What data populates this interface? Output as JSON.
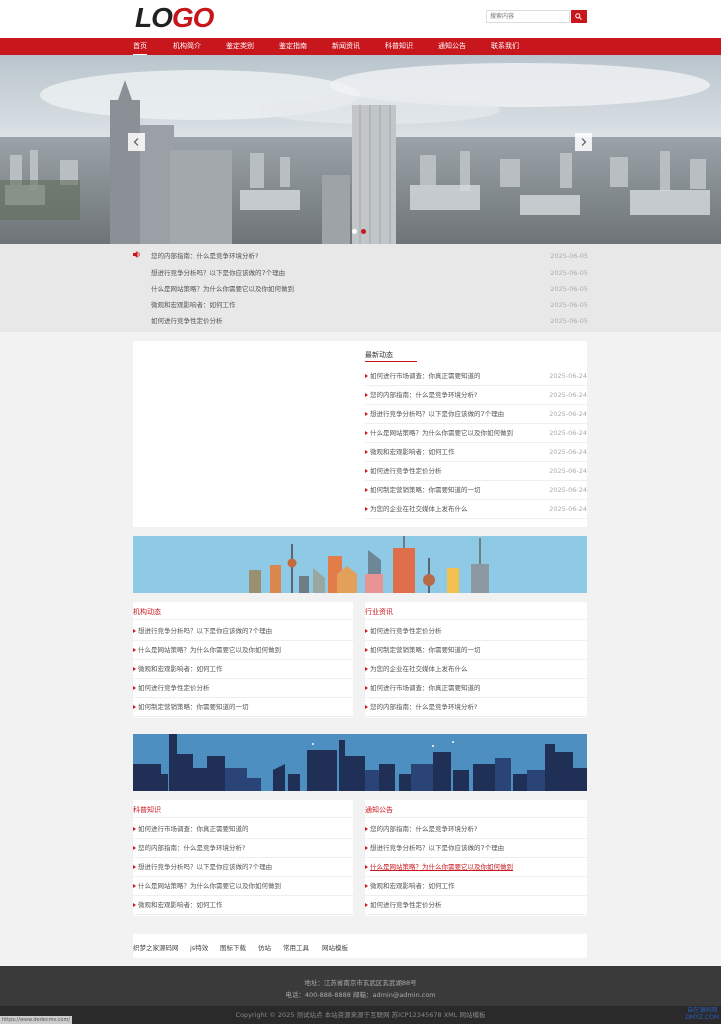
{
  "header": {
    "logo_part1": "LO",
    "logo_part2": "GO",
    "search_placeholder": "搜索内容"
  },
  "nav": {
    "items": [
      "首页",
      "机构简介",
      "鉴定类别",
      "鉴定指南",
      "新闻资讯",
      "科普知识",
      "通知公告",
      "联系我们"
    ]
  },
  "ticker": {
    "items": [
      {
        "title": "您的内部指南：什么是竞争环境分析?",
        "date": "2025-06-05"
      },
      {
        "title": "想进行竞争分析吗？以下是你应该做的7个理由",
        "date": "2025-06-05"
      },
      {
        "title": "什么是网站策略？为什么你需要它以及你如何做到",
        "date": "2025-06-05"
      },
      {
        "title": "微观和宏观影响者：如何工作",
        "date": "2025-06-05"
      },
      {
        "title": "如何进行竞争性定价分析",
        "date": "2025-06-05"
      }
    ]
  },
  "latest": {
    "title": "最新动态",
    "items": [
      {
        "title": "如何进行市场调查：你真正需要知道的",
        "date": "2025-06-24"
      },
      {
        "title": "您的内部指南：什么是竞争环境分析?",
        "date": "2025-06-24"
      },
      {
        "title": "想进行竞争分析吗？以下是你应该做的7个理由",
        "date": "2025-06-24"
      },
      {
        "title": "什么是网站策略？为什么你需要它以及你如何做到",
        "date": "2025-06-24"
      },
      {
        "title": "微观和宏观影响者：如何工作",
        "date": "2025-06-24"
      },
      {
        "title": "如何进行竞争性定价分析",
        "date": "2025-06-24"
      },
      {
        "title": "如何制定营销策略：你需要知道的一切",
        "date": "2025-06-24"
      },
      {
        "title": "为您的企业在社交媒体上发布什么",
        "date": "2025-06-24"
      }
    ]
  },
  "sections": {
    "org_news": {
      "title": "机构动态",
      "items": [
        "想进行竞争分析吗？以下是你应该做的7个理由",
        "什么是网站策略？为什么你需要它以及你如何做到",
        "微观和宏观影响者：如何工作",
        "如何进行竞争性定价分析",
        "如何制定营销策略：你需要知道的一切"
      ]
    },
    "industry": {
      "title": "行业资讯",
      "items": [
        "如何进行竞争性定价分析",
        "如何制定营销策略：你需要知道的一切",
        "为您的企业在社交媒体上发布什么",
        "如何进行市场调查：你真正需要知道的",
        "您的内部指南：什么是竞争环境分析?"
      ]
    },
    "science": {
      "title": "科普知识",
      "items": [
        "如何进行市场调查：你真正需要知道的",
        "您的内部指南：什么是竞争环境分析?",
        "想进行竞争分析吗？以下是你应该做的7个理由",
        "什么是网站策略？为什么你需要它以及你如何做到",
        "微观和宏观影响者：如何工作"
      ]
    },
    "notice": {
      "title": "通知公告",
      "items": [
        "您的内部指南：什么是竞争环境分析?",
        "想进行竞争分析吗？以下是你应该做的7个理由",
        "什么是网站策略？为什么你需要它以及你如何做到",
        "微观和宏观影响者：如何工作",
        "如何进行竞争性定价分析"
      ]
    }
  },
  "links": [
    "织梦之家源码网",
    "js特效",
    "图标下载",
    "仿站",
    "常用工具",
    "网站模板"
  ],
  "footer": {
    "address": "地址：江苏省南京市玄武区玄武湖88号",
    "contact": "电话：400-888-8888    邮箱：admin@admin.com",
    "copyright": "Copyright © 2025 测试站点 本站资源来源于互联网 苏ICP12345678 XML 网站模板"
  },
  "status_tip": "https://www.dedecms.com/",
  "watermark_line1": "自在源码网",
  "watermark_line2": "DMYZ.COM"
}
